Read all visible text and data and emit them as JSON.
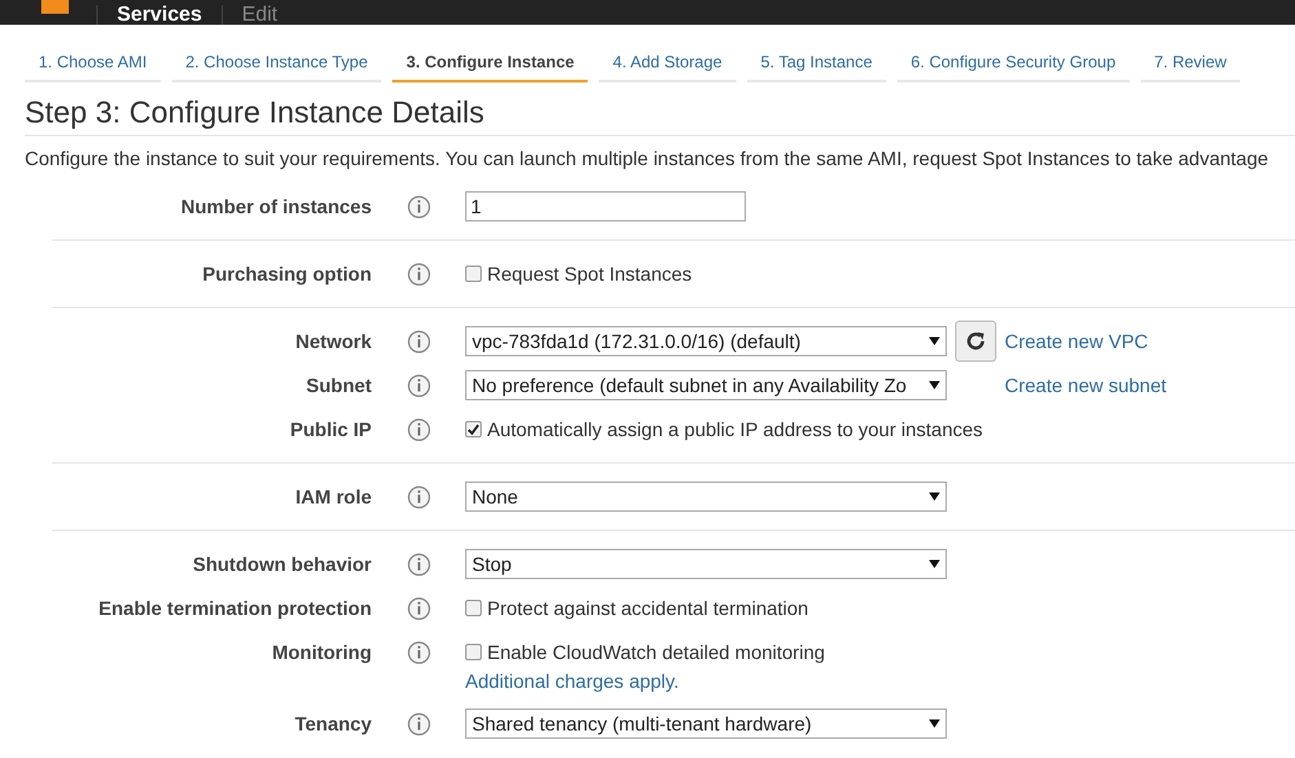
{
  "top_bar": {
    "menus": [
      "Services",
      "Edit"
    ]
  },
  "steps": [
    {
      "label": "1. Choose AMI",
      "selected": false
    },
    {
      "label": "2. Choose Instance Type",
      "selected": false
    },
    {
      "label": "3. Configure Instance",
      "selected": true
    },
    {
      "label": "4. Add Storage",
      "selected": false
    },
    {
      "label": "5. Tag Instance",
      "selected": false
    },
    {
      "label": "6. Configure Security Group",
      "selected": false
    },
    {
      "label": "7. Review",
      "selected": false
    }
  ],
  "heading": "Step 3: Configure Instance Details",
  "description": "Configure the instance to suit your requirements. You can launch multiple instances from the same AMI, request Spot Instances to take advantage",
  "sections": [
    {
      "fields": [
        {
          "label": "Number of instances",
          "kind": "text",
          "value": "1"
        }
      ]
    },
    {
      "fields": [
        {
          "label": "Purchasing option",
          "kind": "checkbox",
          "text": "Request Spot Instances",
          "checked": false
        }
      ]
    },
    {
      "fields": [
        {
          "label": "Network",
          "kind": "select",
          "value": "vpc-783fda1d (172.31.0.0/16) (default)",
          "refresh_button": true,
          "link": "Create new VPC"
        },
        {
          "label": "Subnet",
          "kind": "select",
          "value": "No preference (default subnet in any Availability Zo",
          "refresh_button": false,
          "link": "Create new subnet"
        },
        {
          "label": "Public IP",
          "kind": "checkbox",
          "text": "Automatically assign a public IP address to your instances",
          "checked": true
        }
      ]
    },
    {
      "fields": [
        {
          "label": "IAM role",
          "kind": "select",
          "value": "None"
        }
      ]
    },
    {
      "fields": [
        {
          "label": "Shutdown behavior",
          "kind": "select",
          "value": "Stop"
        },
        {
          "label": "Enable termination protection",
          "kind": "checkbox",
          "text": "Protect against accidental termination",
          "checked": false
        },
        {
          "label": "Monitoring",
          "kind": "checkbox",
          "text": "Enable CloudWatch detailed monitoring",
          "checked": false,
          "note": "Additional charges apply."
        },
        {
          "label": "Tenancy",
          "kind": "select",
          "value": "Shared tenancy (multi-tenant hardware)"
        }
      ]
    }
  ]
}
